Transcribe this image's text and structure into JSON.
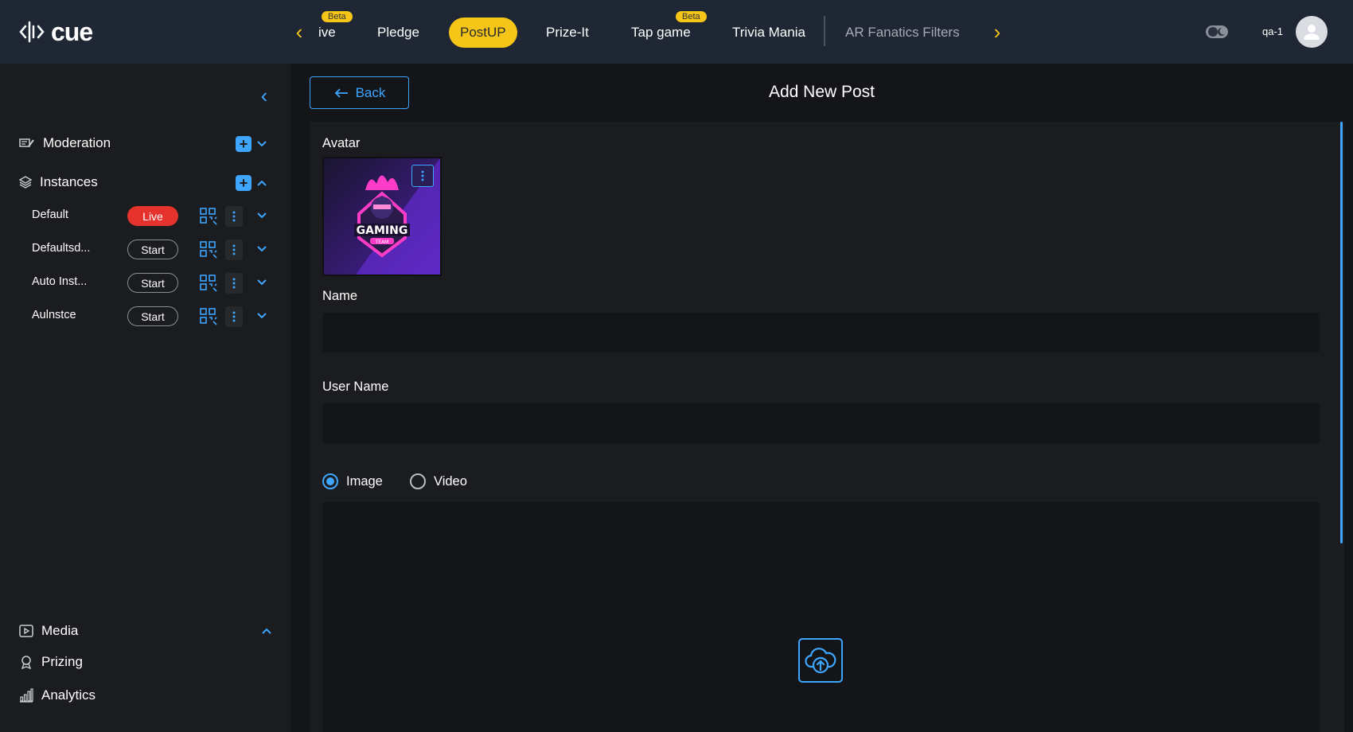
{
  "header": {
    "logo_text": "cue",
    "nav_items": [
      {
        "label": "ive",
        "badge": "Beta"
      },
      {
        "label": "Pledge"
      },
      {
        "label": "PostUP",
        "active": true
      },
      {
        "label": "Prize-It"
      },
      {
        "label": "Tap game",
        "badge": "Beta"
      },
      {
        "label": "Trivia Mania"
      },
      {
        "label": "AR Fanatics Filters",
        "muted": true
      }
    ],
    "user_name": "qa-1"
  },
  "sidebar": {
    "moderation_label": "Moderation",
    "instances_label": "Instances",
    "instances": [
      {
        "name": "Default",
        "status": "Live"
      },
      {
        "name": "Defaultsd...",
        "status": "Start"
      },
      {
        "name": "Auto Inst...",
        "status": "Start"
      },
      {
        "name": "Aulnstce",
        "status": "Start"
      }
    ],
    "media_label": "Media",
    "prizing_label": "Prizing",
    "analytics_label": "Analytics"
  },
  "main": {
    "back_label": "Back",
    "title": "Add New Post",
    "avatar_label": "Avatar",
    "avatar_image_text": "GAMING",
    "avatar_image_subtext": "TEAM",
    "name_label": "Name",
    "name_value": "",
    "username_label": "User Name",
    "username_value": "",
    "media_options": [
      {
        "label": "Image",
        "checked": true
      },
      {
        "label": "Video",
        "checked": false
      }
    ]
  },
  "colors": {
    "accent": "#3ea6ff",
    "highlight": "#f5c518",
    "live": "#e5322d",
    "topbar": "#1f2734"
  }
}
